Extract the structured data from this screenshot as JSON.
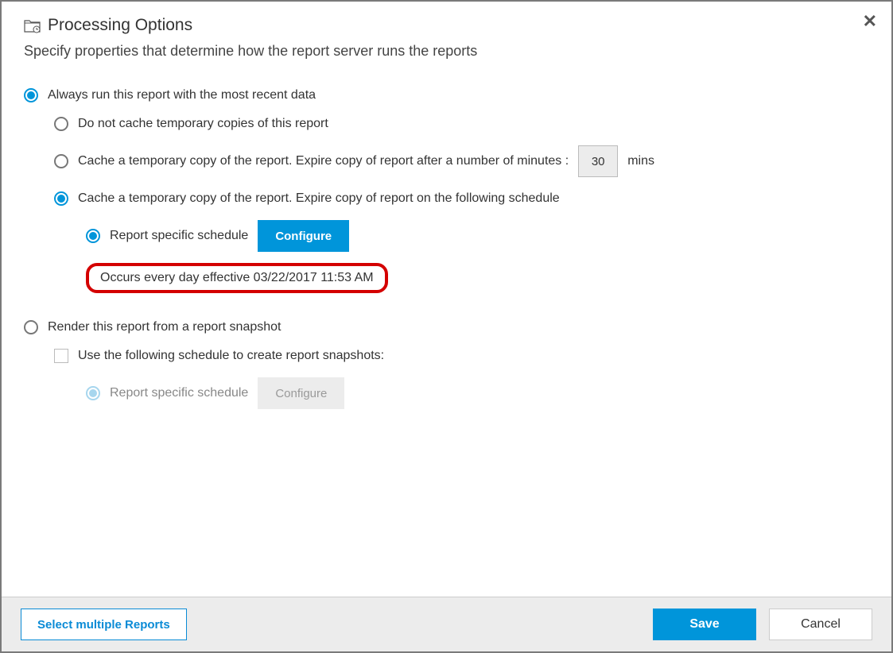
{
  "header": {
    "title": "Processing Options",
    "subtitle": "Specify properties that determine how the report server runs the reports"
  },
  "options": {
    "always_run": "Always run this report with the most recent data",
    "no_cache": "Do not cache temporary copies of this report",
    "cache_minutes": "Cache a temporary copy of the report. Expire copy of report after a number of minutes :",
    "minutes_value": "30",
    "minutes_unit": "mins",
    "cache_schedule": "Cache a temporary copy of the report. Expire copy of report on the following schedule",
    "report_specific_schedule": "Report specific schedule",
    "configure_btn": "Configure",
    "schedule_summary": "Occurs every day effective 03/22/2017 11:53 AM",
    "snapshot": "Render this report from a report snapshot",
    "use_schedule_snapshot": "Use the following schedule to create report snapshots:",
    "snapshot_report_specific": "Report specific schedule",
    "snapshot_configure_btn": "Configure"
  },
  "footer": {
    "select_multiple": "Select multiple Reports",
    "save": "Save",
    "cancel": "Cancel"
  }
}
